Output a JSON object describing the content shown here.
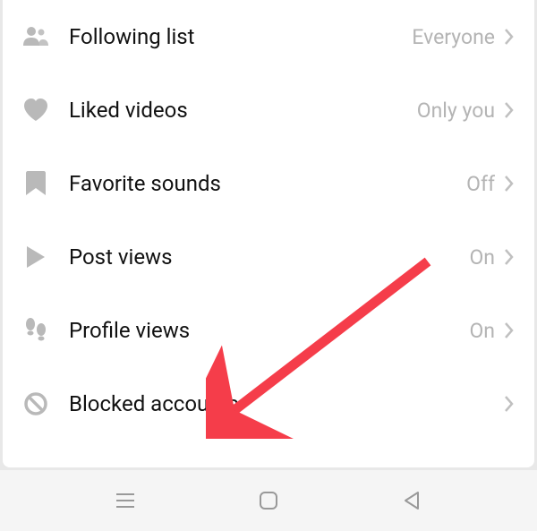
{
  "settings": {
    "items": [
      {
        "label": "Following list",
        "value": "Everyone",
        "icon": "people-icon"
      },
      {
        "label": "Liked videos",
        "value": "Only you",
        "icon": "heart-icon"
      },
      {
        "label": "Favorite sounds",
        "value": "Off",
        "icon": "bookmark-icon"
      },
      {
        "label": "Post views",
        "value": "On",
        "icon": "play-icon"
      },
      {
        "label": "Profile views",
        "value": "On",
        "icon": "footprints-icon"
      },
      {
        "label": "Blocked accounts",
        "value": "",
        "icon": "block-icon"
      }
    ]
  }
}
